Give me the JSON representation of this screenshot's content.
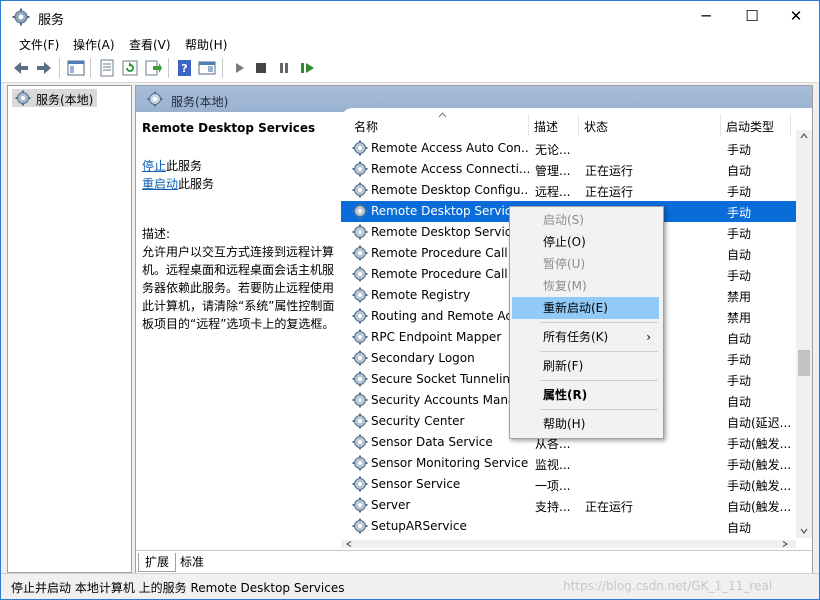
{
  "window": {
    "title": "服务",
    "minimize": "─",
    "maximize": "☐",
    "close": "✕"
  },
  "menu": [
    "文件(F)",
    "操作(A)",
    "查看(V)",
    "帮助(H)"
  ],
  "tree": {
    "item": "服务(本地)"
  },
  "panel": {
    "header": "服务(本地)",
    "service_title": "Remote Desktop Services",
    "stop_link": "停止",
    "stop_suffix": "此服务",
    "restart_link": "重启动",
    "restart_suffix": "此服务",
    "desc_label": "描述:",
    "desc_text": "允许用户以交互方式连接到远程计算机。远程桌面和远程桌面会话主机服务器依赖此服务。若要防止远程使用此计算机，请清除“系统”属性控制面板项目的“远程”选项卡上的复选框。"
  },
  "columns": {
    "name": "名称",
    "desc": "描述",
    "status": "状态",
    "type": "启动类型"
  },
  "rows": [
    {
      "name": "Remote Access Auto Con...",
      "desc": "无论...",
      "status": "",
      "type": "手动"
    },
    {
      "name": "Remote Access Connecti...",
      "desc": "管理...",
      "status": "正在运行",
      "type": "自动"
    },
    {
      "name": "Remote Desktop Configu...",
      "desc": "远程...",
      "status": "正在运行",
      "type": "手动"
    },
    {
      "name": "Remote Desktop Services",
      "desc": "",
      "status": "",
      "type": "手动"
    },
    {
      "name": "Remote Desktop Services",
      "desc": "",
      "status": "",
      "type": "手动"
    },
    {
      "name": "Remote Procedure Call",
      "desc": "",
      "status": "",
      "type": "自动"
    },
    {
      "name": "Remote Procedure Call",
      "desc": "",
      "status": "",
      "type": "手动"
    },
    {
      "name": "Remote Registry",
      "desc": "",
      "status": "",
      "type": "禁用"
    },
    {
      "name": "Routing and Remote Ac",
      "desc": "",
      "status": "",
      "type": "禁用"
    },
    {
      "name": "RPC Endpoint Mapper",
      "desc": "",
      "status": "",
      "type": "自动"
    },
    {
      "name": "Secondary Logon",
      "desc": "",
      "status": "",
      "type": "手动"
    },
    {
      "name": "Secure Socket Tunneling",
      "desc": "",
      "status": "",
      "type": "手动"
    },
    {
      "name": "Security Accounts Mana",
      "desc": "",
      "status": "",
      "type": "自动"
    },
    {
      "name": "Security Center",
      "desc": "",
      "status": "",
      "type": "自动(延迟..."
    },
    {
      "name": "Sensor Data Service",
      "desc": "从各...",
      "status": "",
      "type": "手动(触发..."
    },
    {
      "name": "Sensor Monitoring Service",
      "desc": "监视...",
      "status": "",
      "type": "手动(触发..."
    },
    {
      "name": "Sensor Service",
      "desc": "一项...",
      "status": "",
      "type": "手动(触发..."
    },
    {
      "name": "Server",
      "desc": "支持...",
      "status": "正在运行",
      "type": "自动(触发..."
    },
    {
      "name": "SetupARService",
      "desc": "",
      "status": "",
      "type": "自动"
    }
  ],
  "context_menu": [
    {
      "label": "启动(S)",
      "state": "disabled"
    },
    {
      "label": "停止(O)",
      "state": "normal"
    },
    {
      "label": "暂停(U)",
      "state": "disabled"
    },
    {
      "label": "恢复(M)",
      "state": "disabled"
    },
    {
      "label": "重新启动(E)",
      "state": "highlighted"
    },
    {
      "label": "所有任务(K)",
      "state": "submenu"
    },
    {
      "label": "刷新(F)",
      "state": "normal"
    },
    {
      "label": "属性(R)",
      "state": "bold"
    },
    {
      "label": "帮助(H)",
      "state": "normal"
    }
  ],
  "tabs": [
    "扩展",
    "标准"
  ],
  "status_bar": "停止并启动 本地计算机 上的服务 Remote Desktop Services",
  "watermark": "https://blog.csdn.net/GK_1_11_real",
  "colors": {
    "accent": "#0a6cd8",
    "highlight": "#91c9f7",
    "header": "#a8bdd8"
  }
}
